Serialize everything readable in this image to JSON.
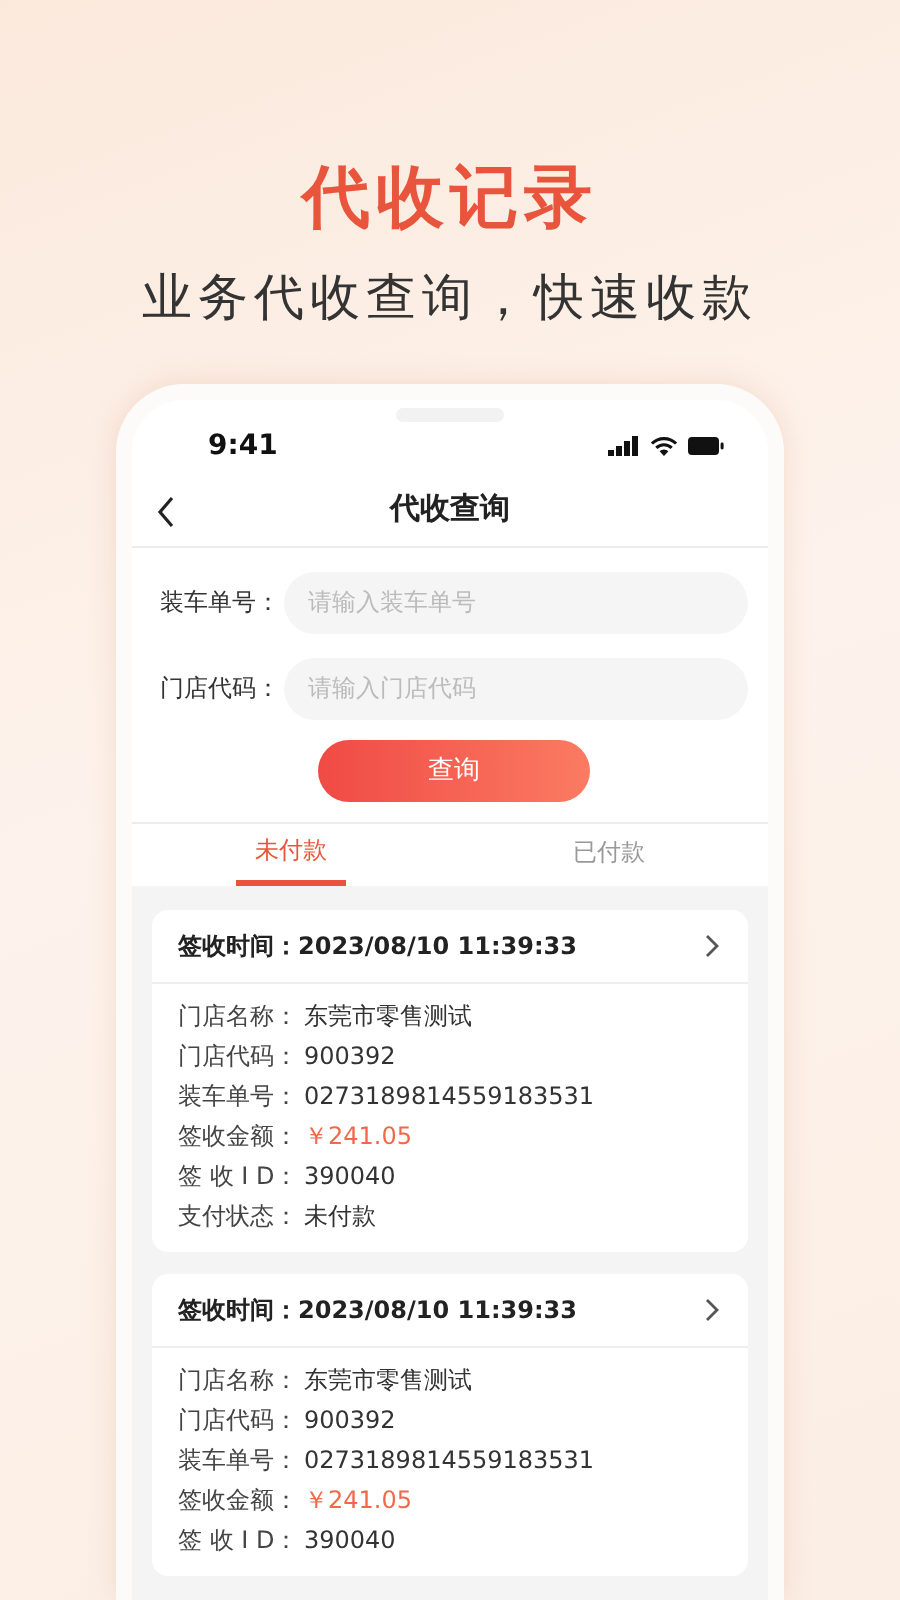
{
  "hero": {
    "title": "代收记录",
    "subtitle": "业务代收查询，快速收款"
  },
  "status_bar": {
    "time": "9:41"
  },
  "nav": {
    "title": "代收查询"
  },
  "form": {
    "fields": [
      {
        "label": "装车单号：",
        "placeholder": "请输入装车单号"
      },
      {
        "label": "门店代码：",
        "placeholder": "请输入门店代码"
      }
    ],
    "button": "查询"
  },
  "tabs": [
    {
      "label": "未付款",
      "selected": true
    },
    {
      "label": "已付款",
      "selected": false
    }
  ],
  "records": [
    {
      "header_label": "签收时间：",
      "time": "2023/08/10 11:39:33",
      "rows": [
        {
          "label": "门店名称：",
          "value": "东莞市零售测试",
          "kind": "text"
        },
        {
          "label": "门店代码：",
          "value": "900392",
          "kind": "text"
        },
        {
          "label": "装车单号：",
          "value": "0273189814559183531",
          "kind": "text"
        },
        {
          "label": "签收金额：",
          "value": "￥241.05",
          "kind": "amount"
        },
        {
          "label": "签 收 I D：",
          "value": "390040",
          "kind": "text"
        },
        {
          "label": "支付状态：",
          "value": "未付款",
          "kind": "text"
        }
      ]
    },
    {
      "header_label": "签收时间：",
      "time": "2023/08/10 11:39:33",
      "rows": [
        {
          "label": "门店名称：",
          "value": "东莞市零售测试",
          "kind": "text"
        },
        {
          "label": "门店代码：",
          "value": "900392",
          "kind": "text"
        },
        {
          "label": "装车单号：",
          "value": "0273189814559183531",
          "kind": "text"
        },
        {
          "label": "签收金额：",
          "value": "￥241.05",
          "kind": "amount"
        },
        {
          "label": "签 收 I D：",
          "value": "390040",
          "kind": "text"
        }
      ]
    }
  ]
}
